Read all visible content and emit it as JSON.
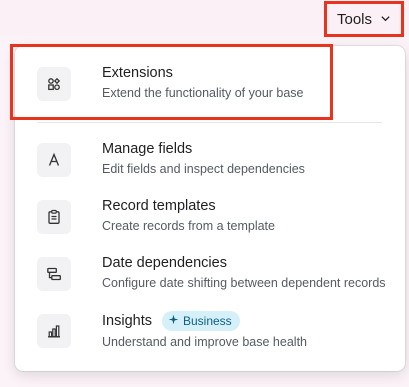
{
  "toolbar": {
    "tools_label": "Tools",
    "tools_icon": "chevron-down-icon"
  },
  "menu": {
    "items": [
      {
        "icon": "extensions-icon",
        "title": "Extensions",
        "description": "Extend the functionality of your base"
      },
      {
        "icon": "field-letter-icon",
        "title": "Manage fields",
        "description": "Edit fields and inspect dependencies"
      },
      {
        "icon": "clipboard-icon",
        "title": "Record templates",
        "description": "Create records from a template"
      },
      {
        "icon": "dependencies-icon",
        "title": "Date dependencies",
        "description": "Configure date shifting between dependent records"
      },
      {
        "icon": "bar-chart-icon",
        "title": "Insights",
        "description": "Understand and improve base health",
        "badge": "Business",
        "badge_icon": "sparkle-icon"
      }
    ]
  },
  "colors": {
    "highlight": "#e8331e",
    "badge_bg": "#d6f0fa",
    "badge_text": "#0b5f82"
  }
}
